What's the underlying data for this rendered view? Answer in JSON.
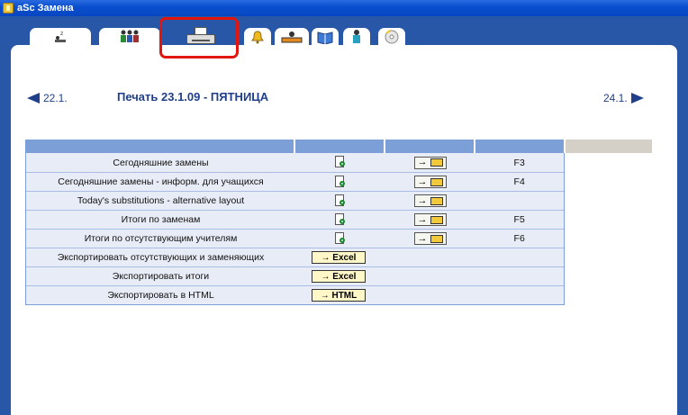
{
  "window": {
    "title": "aSc Замена"
  },
  "tabs": [
    {
      "icon": "sleep-person-icon"
    },
    {
      "icon": "group-icon"
    },
    {
      "icon": "printer-icon",
      "active": true
    },
    {
      "icon": "bell-icon"
    },
    {
      "icon": "desk-icon"
    },
    {
      "icon": "book-icon"
    },
    {
      "icon": "teacher-icon"
    },
    {
      "icon": "disk-icon"
    }
  ],
  "nav": {
    "prev": "22.1.",
    "next": "24.1.",
    "title": "Печать 23.1.09 - ПЯТНИЦА"
  },
  "rows": [
    {
      "label": "Сегодняшние замены",
      "preview": true,
      "print": true,
      "key": "F3"
    },
    {
      "label": "Сегодняшние замены - информ. для учащихся",
      "preview": true,
      "print": true,
      "key": "F4"
    },
    {
      "label": "Today's substitutions - alternative layout",
      "preview": true,
      "print": true,
      "key": ""
    },
    {
      "label": "Итоги по заменам",
      "preview": true,
      "print": true,
      "key": "F5"
    },
    {
      "label": "Итоги по отсутствующим учителям",
      "preview": true,
      "print": true,
      "key": "F6"
    },
    {
      "label": "Экспортировать отсутствующих и заменяющих",
      "export": "→ Excel"
    },
    {
      "label": "Экспортировать итоги",
      "export": "→ Excel"
    },
    {
      "label": "Экспортировать в HTML",
      "export": "→ HTML"
    }
  ],
  "colors": {
    "accent": "#2957a8",
    "highlight": "#e3160f",
    "header": "#7b9fd6"
  }
}
